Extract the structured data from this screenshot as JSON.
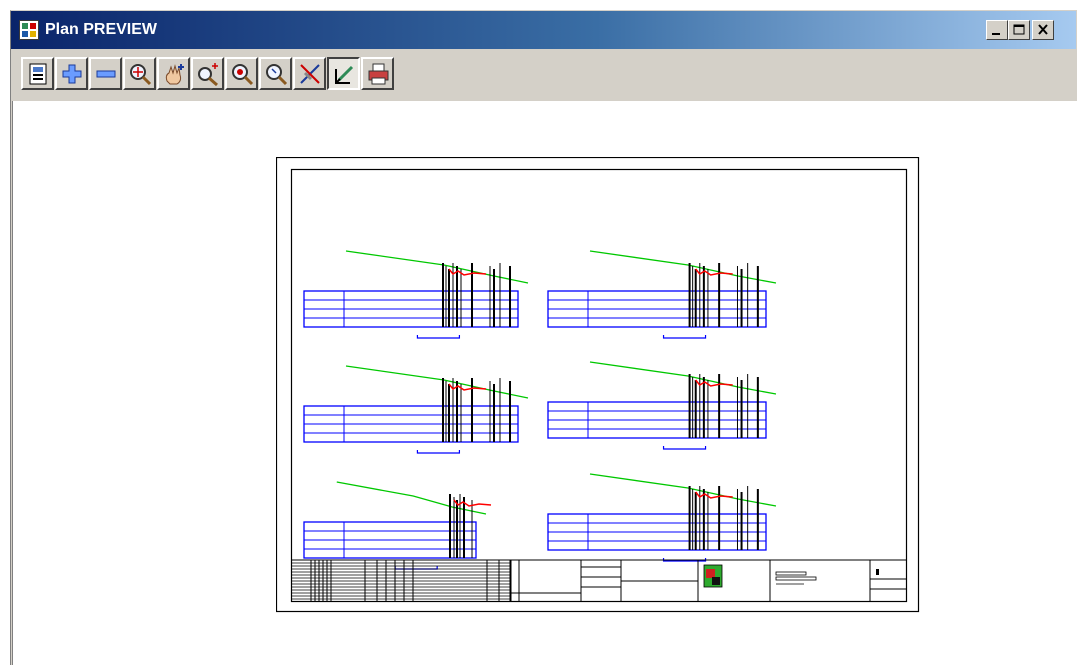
{
  "window": {
    "title": "Plan PREVIEW",
    "icon": "plan-preview-app-icon",
    "controls": [
      {
        "name": "minimize-button",
        "icon": "minimize-icon"
      },
      {
        "name": "maximize-button",
        "icon": "maximize-icon"
      },
      {
        "name": "close-button",
        "icon": "close-icon"
      }
    ]
  },
  "toolbar": {
    "buttons": [
      {
        "name": "page-setup-button",
        "icon": "page-setup-icon",
        "pressed": false
      },
      {
        "name": "zoom-in-button",
        "icon": "plus-icon",
        "pressed": false
      },
      {
        "name": "zoom-out-button",
        "icon": "minus-icon",
        "pressed": false
      },
      {
        "name": "zoom-window-button",
        "icon": "magnifier-target-icon",
        "pressed": false
      },
      {
        "name": "pan-button",
        "icon": "hand-icon",
        "pressed": false
      },
      {
        "name": "zoom-plus-button",
        "icon": "magnifier-plus-icon",
        "pressed": false
      },
      {
        "name": "zoom-extents-button",
        "icon": "magnifier-extents-icon",
        "pressed": false
      },
      {
        "name": "zoom-previous-button",
        "icon": "magnifier-icon",
        "pressed": false
      },
      {
        "name": "measure-button",
        "icon": "measure-icon",
        "pressed": false
      },
      {
        "name": "select-button",
        "icon": "select-pen-icon",
        "pressed": true
      },
      {
        "name": "print-button",
        "icon": "printer-icon",
        "pressed": false
      }
    ]
  },
  "colors": {
    "section_lines": "#0000ff",
    "ground_line": "#00c800",
    "design_marks": "#ff0000",
    "ticks": "#000000"
  }
}
